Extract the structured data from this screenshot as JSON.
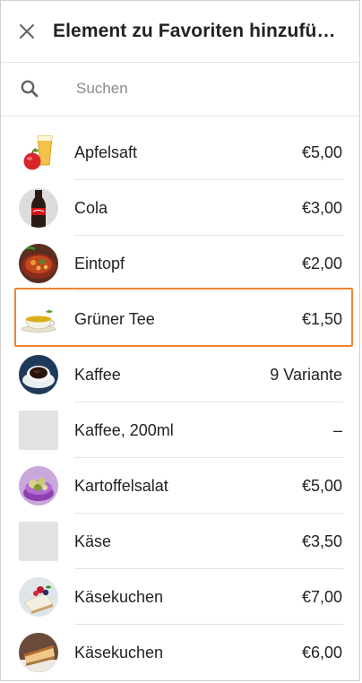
{
  "header": {
    "title": "Element zu Favoriten hinzufügen",
    "close_icon": "close-icon"
  },
  "search": {
    "placeholder": "Suchen",
    "value": ""
  },
  "items": [
    {
      "name": "Apfelsaft",
      "price": "€5,00",
      "thumb": "apple-juice"
    },
    {
      "name": "Cola",
      "price": "€3,00",
      "thumb": "cola"
    },
    {
      "name": "Eintopf",
      "price": "€2,00",
      "thumb": "stew"
    },
    {
      "name": "Grüner Tee",
      "price": "€1,50",
      "thumb": "green-tea",
      "highlighted": true
    },
    {
      "name": "Kaffee",
      "price": "9 Variante",
      "thumb": "coffee"
    },
    {
      "name": "Kaffee, 200ml",
      "price": "–",
      "thumb": "placeholder"
    },
    {
      "name": "Kartoffelsalat",
      "price": "€5,00",
      "thumb": "potato-salad"
    },
    {
      "name": "Käse",
      "price": "€3,50",
      "thumb": "placeholder"
    },
    {
      "name": "Käsekuchen",
      "price": "€7,00",
      "thumb": "cheesecake-berries"
    },
    {
      "name": "Käsekuchen",
      "price": "€6,00",
      "thumb": "cheesecake-slice"
    }
  ],
  "colors": {
    "highlight_border": "#ee8434",
    "divider": "#e4e4e4",
    "placeholder_thumb": "#e3e3e3"
  }
}
